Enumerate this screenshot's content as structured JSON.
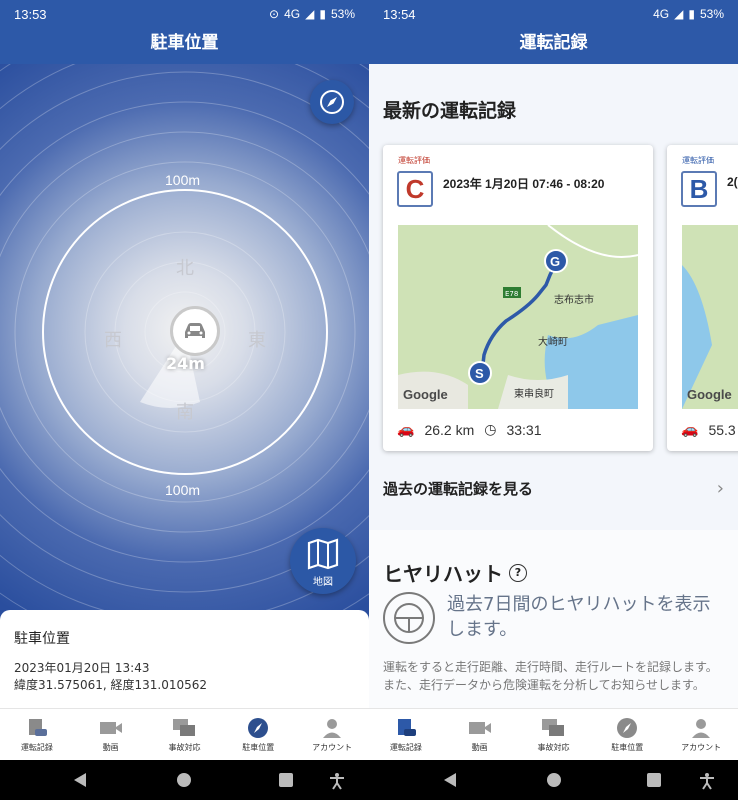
{
  "left": {
    "status_time": "13:53",
    "status_network": "4G",
    "status_battery": "53%",
    "title": "駐車位置",
    "ring_top_label": "100m",
    "ring_bottom_label": "100m",
    "dir_north": "北",
    "dir_south": "南",
    "dir_east": "東",
    "dir_west": "西",
    "distance": "24m",
    "map_button_label": "地図",
    "info": {
      "title": "駐車位置",
      "datetime": "2023年01月20日 13:43",
      "coords": "緯度31.575061, 経度131.010562"
    }
  },
  "right": {
    "status_time": "13:54",
    "status_network": "4G",
    "status_battery": "53%",
    "title": "運転記録",
    "section_title": "最新の運転記録",
    "cards": [
      {
        "eval_label": "運転評価",
        "grade": "C",
        "date": "2023年 1月20日 07:46 - 08:20",
        "distance": "26.2 km",
        "duration": "33:31",
        "map_labels": {
          "road": "E78",
          "town1": "志布志市",
          "town2": "大崎町",
          "town3": "東串良町",
          "google": "Google"
        }
      },
      {
        "eval_label": "運転評価",
        "grade": "B",
        "date": "2(",
        "distance": "55.3",
        "map_labels": {
          "google": "Google"
        }
      }
    ],
    "past_link": "過去の運転記録を見る",
    "hiyari_title": "ヒヤリハット",
    "hiyari_lead": "過去7日間のヒヤリハットを表示します。",
    "hiyari_desc": "運転をすると走行距離、走行時間、走行ルートを記録します。また、走行データから危険運転を分析してお知らせします。"
  },
  "nav": {
    "items": [
      "運転記録",
      "動画",
      "事故対応",
      "駐車位置",
      "アカウント"
    ]
  },
  "colors": {
    "primary": "#2d59a8",
    "grade_c": "#c0392b",
    "grade_b": "#2d59a8"
  }
}
